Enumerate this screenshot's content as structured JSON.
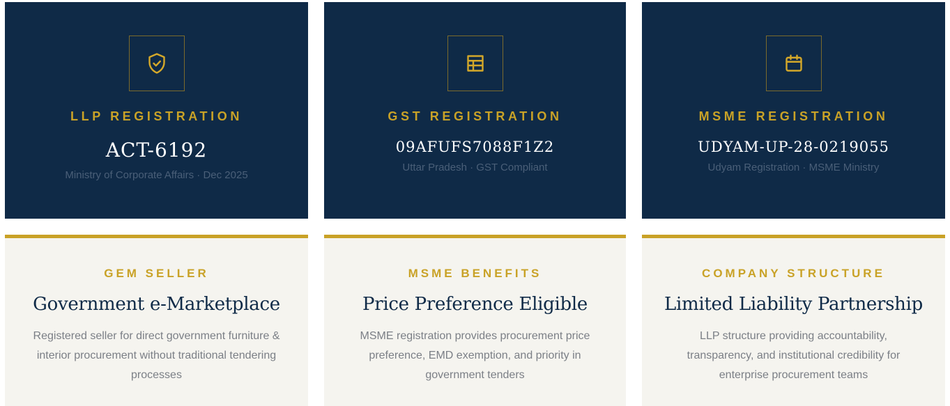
{
  "registrations": [
    {
      "icon": "shield-check-icon",
      "title": "LLP REGISTRATION",
      "value": "ACT-6192",
      "subtitle": "Ministry of Corporate Affairs · Dec 2025"
    },
    {
      "icon": "table-icon",
      "title": "GST REGISTRATION",
      "value": "09AFUFS7088F1Z2",
      "subtitle": "Uttar Pradesh · GST Compliant"
    },
    {
      "icon": "calendar-icon",
      "title": "MSME REGISTRATION",
      "value": "UDYAM-UP-28-0219055",
      "subtitle": "Udyam Registration · MSME Ministry"
    }
  ],
  "features": [
    {
      "title": "GEM SELLER",
      "heading": "Government e-Marketplace",
      "description": "Registered seller for direct government furniture & interior procurement without traditional tendering processes"
    },
    {
      "title": "MSME BENEFITS",
      "heading": "Price Preference Eligible",
      "description": "MSME registration provides procurement price preference, EMD exemption, and priority in government tenders"
    },
    {
      "title": "COMPANY STRUCTURE",
      "heading": "Limited Liability Partnership",
      "description": "LLP structure providing accountability, transparency, and institutional credibility for enterprise procurement teams"
    }
  ],
  "colors": {
    "navy": "#0f2a47",
    "gold": "#c9a227",
    "cream": "#f5f4ef"
  }
}
